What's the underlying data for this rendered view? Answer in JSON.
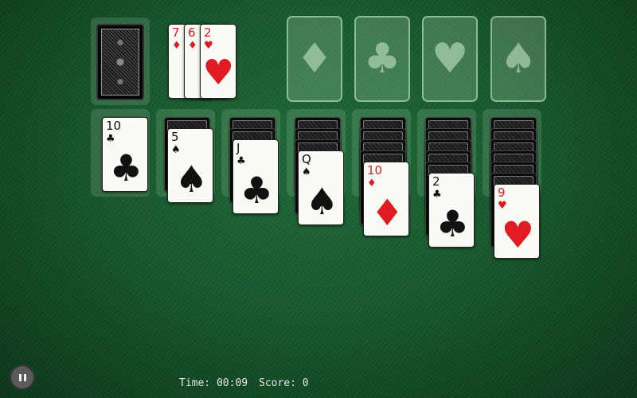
{
  "colors": {
    "felt": "#175a2d",
    "red": "#e11b22",
    "black": "#111111"
  },
  "stock": {
    "icon": "card-back"
  },
  "waste": [
    {
      "rank": "7",
      "suit": "♦",
      "color": "red"
    },
    {
      "rank": "6",
      "suit": "♦",
      "color": "red"
    },
    {
      "rank": "2",
      "suit": "♥",
      "color": "red"
    }
  ],
  "foundations": [
    {
      "suit": "♦",
      "icon": "diamond-icon"
    },
    {
      "suit": "♣",
      "icon": "club-icon"
    },
    {
      "suit": "♥",
      "icon": "heart-icon"
    },
    {
      "suit": "♠",
      "icon": "spade-icon"
    }
  ],
  "tableau": [
    {
      "hidden": 0,
      "rank": "10",
      "suit": "♣",
      "color": "black"
    },
    {
      "hidden": 1,
      "rank": "5",
      "suit": "♠",
      "color": "black"
    },
    {
      "hidden": 2,
      "rank": "J",
      "suit": "♣",
      "color": "black"
    },
    {
      "hidden": 3,
      "rank": "Q",
      "suit": "♠",
      "color": "black"
    },
    {
      "hidden": 4,
      "rank": "10",
      "suit": "♦",
      "color": "red"
    },
    {
      "hidden": 5,
      "rank": "2",
      "suit": "♣",
      "color": "black"
    },
    {
      "hidden": 6,
      "rank": "9",
      "suit": "♥",
      "color": "red"
    }
  ],
  "status": {
    "time_label": "Time: 00:09",
    "score_label": "Score: 0"
  },
  "controls": {
    "pause_icon": "pause-icon"
  }
}
